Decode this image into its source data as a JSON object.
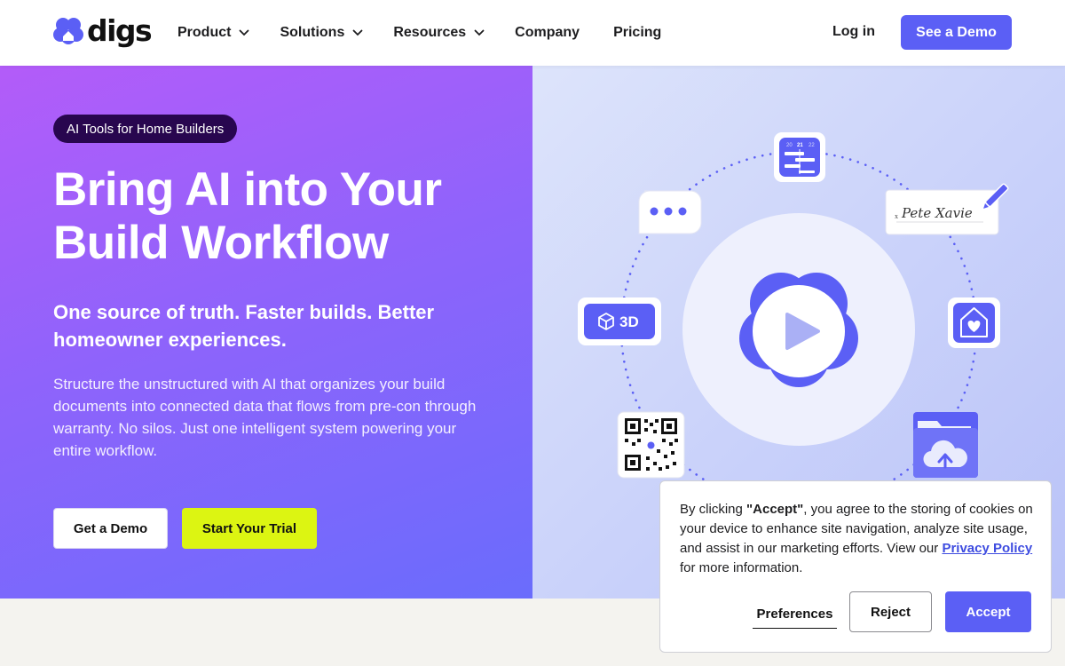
{
  "brand": {
    "name": "digs",
    "accent": "#5b5ff5"
  },
  "nav": {
    "items": [
      {
        "label": "Product",
        "has_dropdown": true
      },
      {
        "label": "Solutions",
        "has_dropdown": true
      },
      {
        "label": "Resources",
        "has_dropdown": true
      },
      {
        "label": "Company",
        "has_dropdown": false
      },
      {
        "label": "Pricing",
        "has_dropdown": false
      }
    ],
    "login": "Log in",
    "cta": "See a Demo"
  },
  "hero": {
    "badge": "AI Tools for Home Builders",
    "headline_line1": "Bring AI into Your",
    "headline_line2": "Build Workflow",
    "subhead": "One source of truth. Faster builds. Better homeowner experiences.",
    "description": "Structure the unstructured with AI that organizes your build documents into connected data that flows from pre-con through warranty. No silos. Just one intelligent system powering your entire workflow.",
    "primary_button": "Get a Demo",
    "secondary_button": "Start Your Trial",
    "secondary_color": "#dcf512"
  },
  "illustration": {
    "calendar_days": [
      "20",
      "21",
      "22"
    ],
    "badge_3d": "3D",
    "signature": "Pete Xavie",
    "signature_mark": "x"
  },
  "cookie": {
    "text_before": "By clicking ",
    "accept_quote": "\"Accept\"",
    "text_middle": ", you agree to the storing of cookies on your device to enhance site navigation, analyze site usage, and assist in our marketing efforts. View our ",
    "privacy_link": "Privacy Policy",
    "text_after": " for more information.",
    "preferences": "Preferences",
    "reject": "Reject",
    "accept": "Accept"
  }
}
